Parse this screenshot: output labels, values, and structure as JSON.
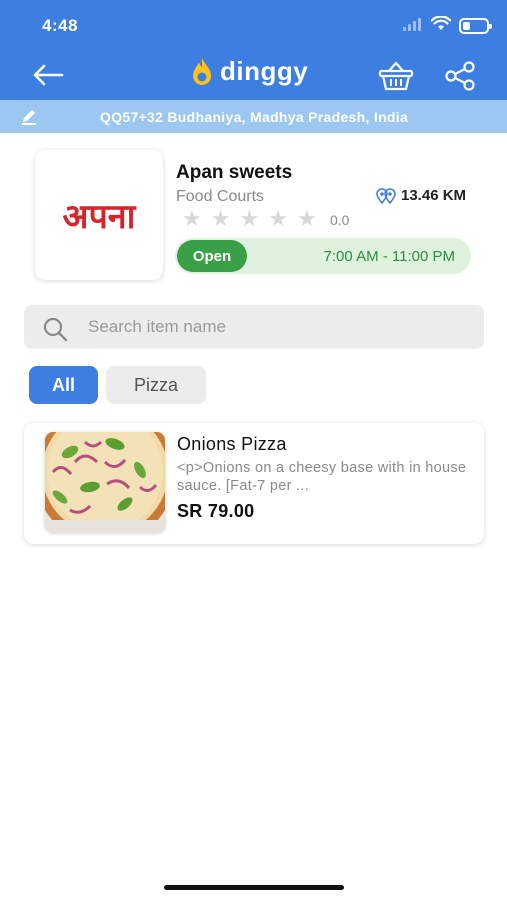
{
  "status_bar": {
    "time": "4:48",
    "battery_level": 0.3
  },
  "header": {
    "logo_text": "dinggy",
    "back_icon": "arrow-left-icon",
    "cart_icon": "basket-icon",
    "share_icon": "share-icon"
  },
  "location": {
    "text": "QQ57+32 Budhaniya, Madhya Pradesh, India",
    "icon": "pencil-icon"
  },
  "store": {
    "logo_text": "अपना",
    "name": "Apan sweets",
    "category": "Food Courts",
    "distance": "13.46 KM",
    "rating": "0.0",
    "rating_stars": 0,
    "status": "Open",
    "hours": "7:00 AM - 11:00 PM"
  },
  "search": {
    "placeholder": "Search item name",
    "value": ""
  },
  "filters": {
    "all_label": "All",
    "pizza_label": "Pizza",
    "active": "All"
  },
  "items": [
    {
      "name": "Onions Pizza",
      "description": "<p>Onions on a cheesy base with in house sauce. [Fat-7 per ...",
      "price": "SR 79.00"
    }
  ],
  "colors": {
    "primary": "#3d7fe0",
    "location_bar": "#9cc7f0",
    "open_green": "#3aa047",
    "brand_red": "#d8232a"
  }
}
